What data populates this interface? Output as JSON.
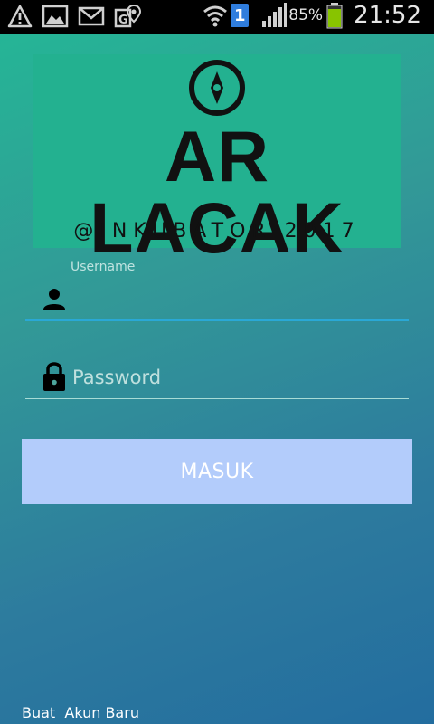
{
  "status_bar": {
    "left_icons": [
      "warning-icon",
      "gallery-icon",
      "mail-icon",
      "maps-notification-icon"
    ],
    "right_icons": [
      "wifi-icon",
      "sim-icon",
      "signal-icon",
      "battery-icon"
    ],
    "sim_number": "1",
    "battery_percent": "85%",
    "time": "21:52"
  },
  "logo": {
    "title": "AR LACAK",
    "subtitle": "@INKUBATOR 2017",
    "icon": "compass-icon"
  },
  "form": {
    "username_label": "Username",
    "username_value": "",
    "username_icon": "person-icon",
    "password_placeholder": "Password",
    "password_value": "",
    "password_icon": "lock-icon",
    "login_label": "MASUK",
    "create_account_label": "Buat  Akun Baru"
  },
  "colors": {
    "gradient_top": "#25b596",
    "gradient_bottom": "#236d9f",
    "logo_bg": "#23b190",
    "button_bg": "#b3ccfb",
    "focus_underline": "#2aa8d6"
  }
}
